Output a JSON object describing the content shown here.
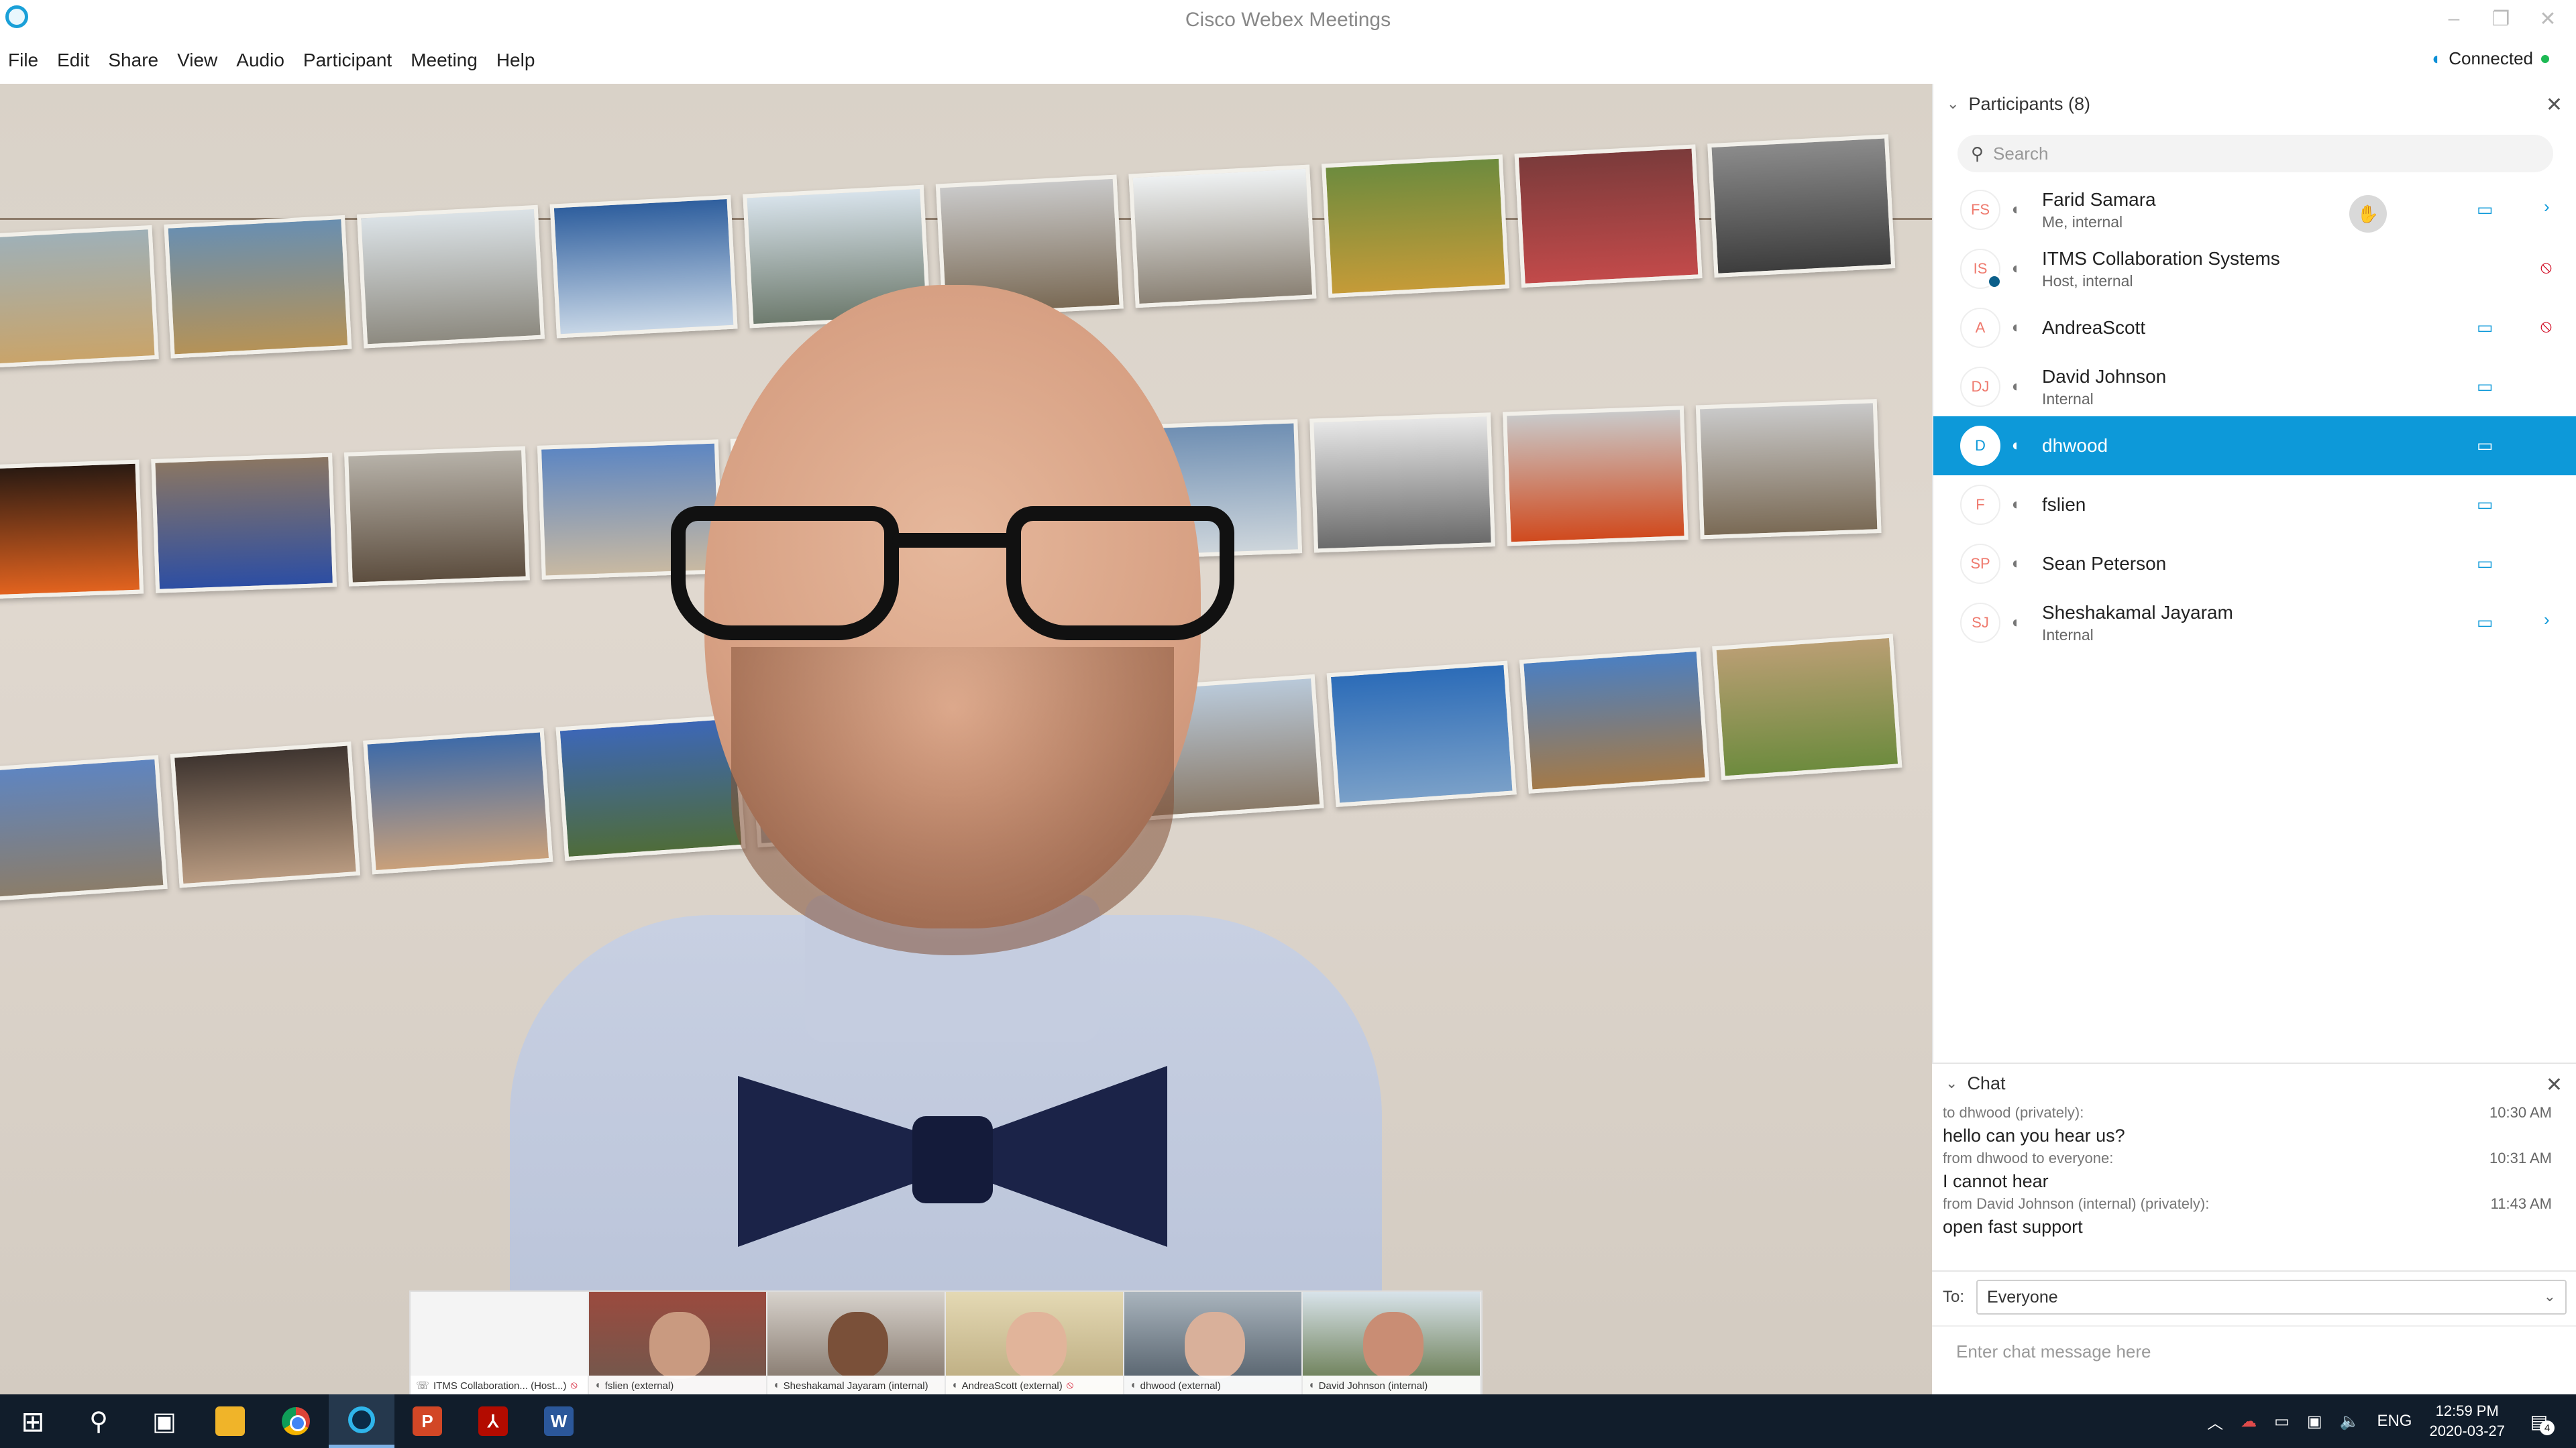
{
  "window": {
    "title": "Cisco Webex Meetings"
  },
  "menu": {
    "items": [
      {
        "label": "File"
      },
      {
        "label": "Edit"
      },
      {
        "label": "Share"
      },
      {
        "label": "View"
      },
      {
        "label": "Audio"
      },
      {
        "label": "Participant"
      },
      {
        "label": "Meeting"
      },
      {
        "label": "Help"
      }
    ],
    "status": "Connected"
  },
  "filmstrip": {
    "thumbs": [
      {
        "label": "ITMS Collaboration... (Host...)",
        "muted": true
      },
      {
        "label": "fslien (external)"
      },
      {
        "label": "Sheshakamal Jayaram (internal)"
      },
      {
        "label": "AndreaScott (external)",
        "muted": true
      },
      {
        "label": "dhwood (external)"
      },
      {
        "label": "David Johnson (internal)"
      }
    ]
  },
  "participants": {
    "header": "Participants (8)",
    "search_placeholder": "Search",
    "list": [
      {
        "initials": "FS",
        "name": "Farid Samara",
        "sub": "Me, internal"
      },
      {
        "initials": "IS",
        "name": "ITMS Collaboration Systems",
        "sub": "Host, internal"
      },
      {
        "initials": "A",
        "name": "AndreaScott",
        "sub": ""
      },
      {
        "initials": "DJ",
        "name": "David Johnson",
        "sub": "Internal"
      },
      {
        "initials": "D",
        "name": "dhwood",
        "sub": ""
      },
      {
        "initials": "F",
        "name": "fslien",
        "sub": ""
      },
      {
        "initials": "SP",
        "name": "Sean Peterson",
        "sub": ""
      },
      {
        "initials": "SJ",
        "name": "Sheshakamal Jayaram",
        "sub": "Internal"
      }
    ]
  },
  "chat": {
    "header": "Chat",
    "messages": [
      {
        "meta": "to dhwood (privately):",
        "time": "10:30 AM",
        "body": "hello can you hear us?"
      },
      {
        "meta": "from dhwood to everyone:",
        "time": "10:31 AM",
        "body": "I cannot hear"
      },
      {
        "meta": "from David Johnson (internal) (privately):",
        "time": "11:43 AM",
        "body": "open fast support"
      }
    ],
    "to_label": "To:",
    "to_value": "Everyone",
    "input_placeholder": "Enter chat message here"
  },
  "taskbar": {
    "tray": {
      "lang": "ENG",
      "time": "12:59 PM",
      "date": "2020-03-27",
      "notifications": "4"
    }
  },
  "colors": {
    "accent": "#0d99d9",
    "mute_red": "#d0021b",
    "taskbar": "#111d2b"
  }
}
